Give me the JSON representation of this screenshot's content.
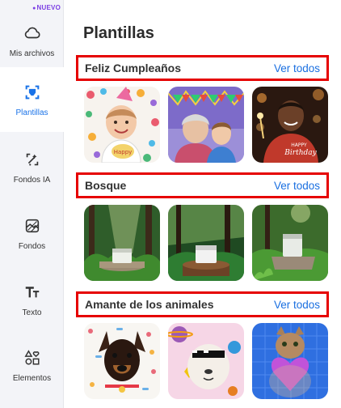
{
  "sidebar": {
    "new_badge": "NUEVO",
    "items": [
      {
        "label": "Mis archivos",
        "icon": "cloud-icon"
      },
      {
        "label": "Plantillas",
        "icon": "template-icon"
      },
      {
        "label": "Fondos IA",
        "icon": "ai-background-icon"
      },
      {
        "label": "Fondos",
        "icon": "background-icon"
      },
      {
        "label": "Texto",
        "icon": "text-icon"
      },
      {
        "label": "Elementos",
        "icon": "elements-icon"
      }
    ]
  },
  "main": {
    "title": "Plantillas",
    "sections": [
      {
        "title": "Feliz Cumpleaños",
        "see_all": "Ver todos"
      },
      {
        "title": "Bosque",
        "see_all": "Ver todos"
      },
      {
        "title": "Amante de los animales",
        "see_all": "Ver todos"
      }
    ]
  },
  "colors": {
    "accent": "#1a6fe0",
    "highlight": "#e60000",
    "badge": "#7b3fe4"
  }
}
